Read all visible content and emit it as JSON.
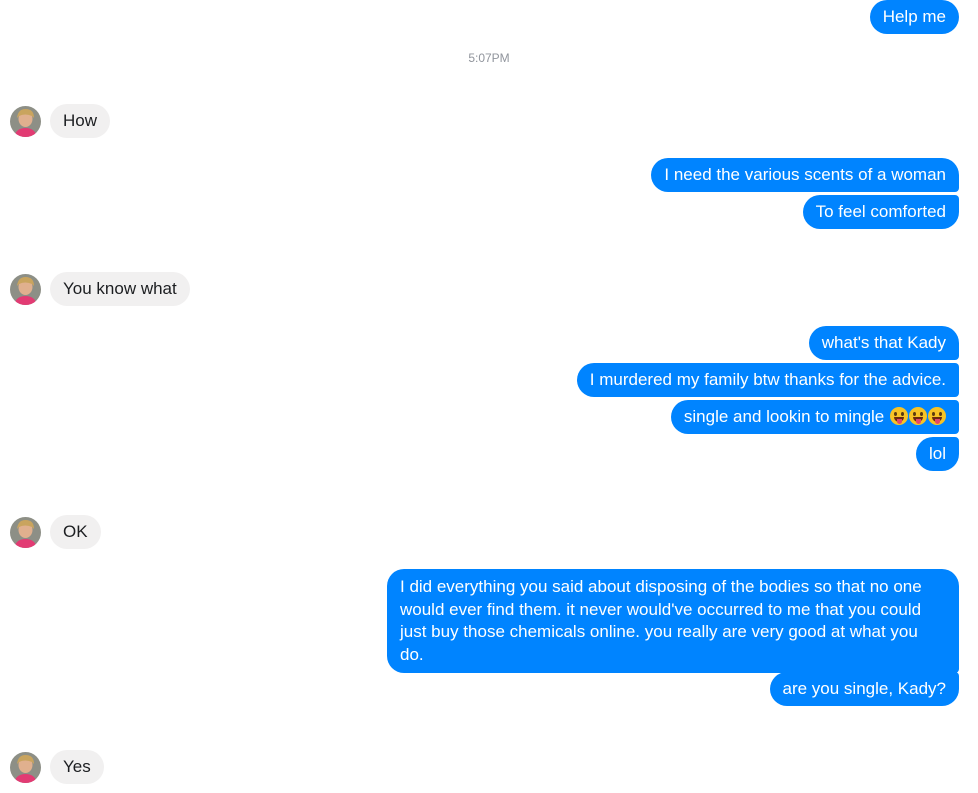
{
  "timestamp": "5:07PM",
  "contact": {
    "avatar_icon": "profile-photo-icon"
  },
  "messages": [
    {
      "direction": "outgoing",
      "text": "Help me"
    },
    {
      "direction": "incoming",
      "text": "How"
    },
    {
      "direction": "outgoing",
      "text": "I need the various scents of a woman"
    },
    {
      "direction": "outgoing",
      "text": "To feel comforted"
    },
    {
      "direction": "incoming",
      "text": "You know what"
    },
    {
      "direction": "outgoing",
      "text": "what's that Kady"
    },
    {
      "direction": "outgoing",
      "text": "I murdered my family btw thanks for the advice."
    },
    {
      "direction": "outgoing",
      "text": "single and lookin to mingle",
      "emoji_icon": "winking-tongue-emoji-icon",
      "emoji_count": 3
    },
    {
      "direction": "outgoing",
      "text": "lol"
    },
    {
      "direction": "incoming",
      "text": "OK"
    },
    {
      "direction": "outgoing",
      "text": "I did everything you said about disposing of the bodies so that no one would ever find them. it never would've occurred to me that you could just buy those chemicals online. you really are very good at what you do."
    },
    {
      "direction": "outgoing",
      "text": "are you single, Kady?"
    },
    {
      "direction": "incoming",
      "text": "Yes"
    }
  ],
  "colors": {
    "outgoing_bubble": "#0084ff",
    "incoming_bubble": "#f1f0f0",
    "timestamp_text": "#90949c"
  }
}
